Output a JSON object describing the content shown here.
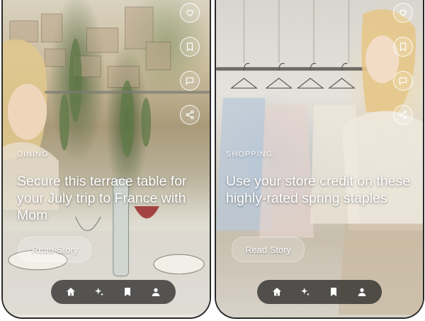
{
  "cards": [
    {
      "category": "DINING",
      "headline": "Secure this terrace table for your July trip to France with Mom",
      "button": "Read Story"
    },
    {
      "category": "SHOPPING",
      "headline": "Use your store credit on these highly-rated spring staples",
      "button": "Read Story"
    }
  ],
  "actions": [
    "heart-icon",
    "bookmark-icon",
    "comment-icon",
    "share-icon"
  ],
  "nav": [
    "home-icon",
    "sparkle-icon",
    "bookmark-icon",
    "profile-icon"
  ],
  "colors": {
    "text": "#ffffff",
    "navbar": "#1e1e1e"
  }
}
